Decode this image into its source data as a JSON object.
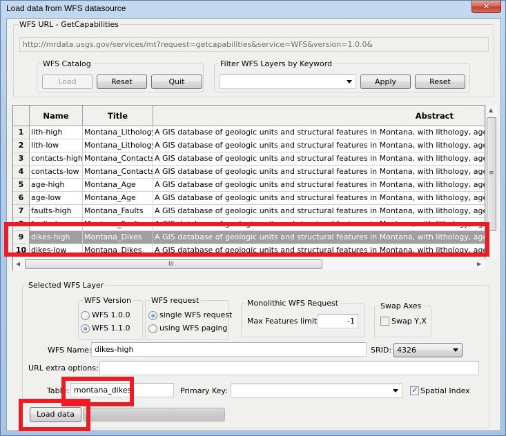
{
  "window": {
    "title": "Load data from WFS datasource",
    "close_icon": "close-icon"
  },
  "url_group": {
    "legend": "WFS URL - GetCapabilities",
    "url_value": "http://mrdata.usgs.gov/services/mt?request=getcapabilities&service=WFS&version=1.0.0&"
  },
  "catalog": {
    "legend": "WFS Catalog",
    "load_label": "Load",
    "reset_label": "Reset",
    "quit_label": "Quit"
  },
  "filter": {
    "legend": "Filter WFS Layers by Keyword",
    "keyword_value": "",
    "apply_label": "Apply",
    "reset_label": "Reset"
  },
  "table": {
    "columns": [
      "Name",
      "Title",
      "Abstract"
    ],
    "rows": [
      {
        "num": "1",
        "name": "lith-high",
        "title": "Montana_Lithology",
        "abstract": "A GIS database of geologic units and structural features in Montana, with lithology, age, data stru"
      },
      {
        "num": "2",
        "name": "lith-low",
        "title": "Montana_Lithology",
        "abstract": "A GIS database of geologic units and structural features in Montana, with lithology, age, data stru"
      },
      {
        "num": "3",
        "name": "contacts-high",
        "title": "Montana_Contacts",
        "abstract": "A GIS database of geologic units and structural features in Montana, with lithology, age, data stru"
      },
      {
        "num": "4",
        "name": "contacts-low",
        "title": "Montana_Contacts",
        "abstract": "A GIS database of geologic units and structural features in Montana, with lithology, age, data stru"
      },
      {
        "num": "5",
        "name": "age-high",
        "title": "Montana_Age",
        "abstract": "A GIS database of geologic units and structural features in Montana, with lithology, age, data stru"
      },
      {
        "num": "6",
        "name": "age-low",
        "title": "Montana_Age",
        "abstract": "A GIS database of geologic units and structural features in Montana, with lithology, age, data stru"
      },
      {
        "num": "7",
        "name": "faults-high",
        "title": "Montana_Faults",
        "abstract": "A GIS database of geologic units and structural features in Montana, with lithology, age, data stru"
      },
      {
        "num": "8",
        "name": "faults-low",
        "title": "Montana_Faults",
        "abstract": "A GIS database of geologic units and structural features in Montana, with lithology, age, data stru"
      },
      {
        "num": "9",
        "name": "dikes-high",
        "title": "Montana_Dikes",
        "abstract": "A GIS database of geologic units and structural features in Montana, with lithology, age, data stru",
        "selected": true
      },
      {
        "num": "10",
        "name": "dikes-low",
        "title": "Montana_Dikes",
        "abstract": "A GIS database of geologic units and structural features in Montana, with lithology, age, data stru"
      }
    ],
    "hscroll_grip": "III",
    "vscroll_grip": "≡"
  },
  "selected_layer": {
    "legend": "Selected WFS Layer",
    "version": {
      "legend": "WFS Version",
      "options": [
        "WFS 1.0.0",
        "WFS 1.1.0"
      ],
      "selected": "WFS 1.1.0"
    },
    "request": {
      "legend": "WFS request",
      "options": [
        "single WFS request",
        "using WFS paging"
      ],
      "selected": "single WFS request"
    },
    "monolithic": {
      "legend": "Monolithic WFS Request",
      "max_label": "Max Features limit:",
      "max_value": "-1"
    },
    "swap": {
      "legend": "Swap Axes",
      "checkbox_label": "Swap Y,X",
      "checked": false
    },
    "wfs_name_label": "WFS Name:",
    "wfs_name_value": "dikes-high",
    "srid_label": "SRID:",
    "srid_value": "4326",
    "url_extra_label": "URL extra options:",
    "url_extra_value": "",
    "table_label": "Table:",
    "table_value": "montana_dikes",
    "pk_label": "Primary Key:",
    "pk_value": "",
    "spatial_index_label": "Spatial Index",
    "spatial_index_checked": true,
    "load_data_label": "Load data",
    "progress_percent": 0
  },
  "colors": {
    "annotation": "#ed1c24",
    "selected_row": "#9f9f9f"
  }
}
